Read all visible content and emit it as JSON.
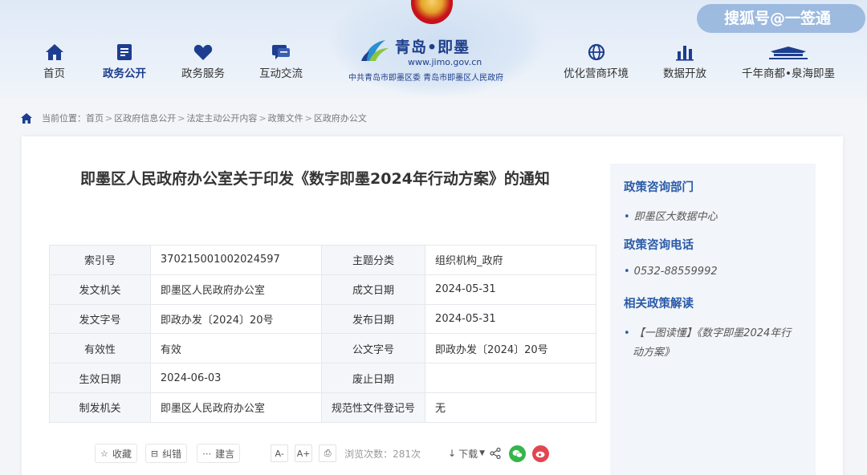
{
  "header": {
    "nav_left": [
      {
        "label": "首页",
        "icon": "home-icon"
      },
      {
        "label": "政务公开",
        "icon": "document-icon",
        "active": true
      },
      {
        "label": "政务服务",
        "icon": "heart-icon"
      },
      {
        "label": "互动交流",
        "icon": "chat-icon"
      }
    ],
    "nav_right": [
      {
        "label": "优化营商环境",
        "icon": "globe-icon"
      },
      {
        "label": "数据开放",
        "icon": "bar-chart-icon"
      },
      {
        "label": "千年商都•泉海即墨",
        "icon": "landmark-icon"
      }
    ],
    "logo": {
      "title": "青岛•即墨",
      "url": "www.jimo.gov.cn",
      "subtitle": "中共青岛市即墨区委  青岛市即墨区人民政府"
    },
    "watermark": "搜狐号@一签通"
  },
  "breadcrumb": {
    "prefix": "当前位置：",
    "items": [
      "首页",
      "区政府信息公开",
      "法定主动公开内容",
      "政策文件",
      "区政府办公文"
    ]
  },
  "document": {
    "title": "即墨区人民政府办公室关于印发《数字即墨2024年行动方案》的通知",
    "meta_rows": [
      [
        "索引号",
        "370215001002024597",
        "主题分类",
        "组织机构_政府"
      ],
      [
        "发文机关",
        "即墨区人民政府办公室",
        "成文日期",
        "2024-05-31"
      ],
      [
        "发文字号",
        "即政办发〔2024〕20号",
        "发布日期",
        "2024-05-31"
      ],
      [
        "有效性",
        "有效",
        "公文字号",
        "即政办发〔2024〕20号"
      ],
      [
        "生效日期",
        "2024-06-03",
        "废止日期",
        ""
      ],
      [
        "制发机关",
        "即墨区人民政府办公室",
        "规范性文件登记号",
        "无"
      ]
    ]
  },
  "toolbar": {
    "favorite": "收藏",
    "correction": "纠错",
    "suggestion": "建言",
    "font_decrease": "A-",
    "font_increase": "A+",
    "print_glyph": "⎙",
    "views": "浏览次数：281次",
    "download": "下载"
  },
  "sidebar": {
    "dept_heading": "政策咨询部门",
    "dept_item": "即墨区大数据中心",
    "phone_heading": "政策咨询电话",
    "phone_item": "0532-88559992",
    "related_heading": "相关政策解读",
    "related_item_line1": "【一图读懂】《数字即墨2024年行",
    "related_item_line2": "动方案》"
  },
  "colors": {
    "brand_blue": "#1d3e8f",
    "link_blue": "#2a5aa8",
    "wechat_green": "#35b54a",
    "weibo_red": "#e0474f"
  }
}
